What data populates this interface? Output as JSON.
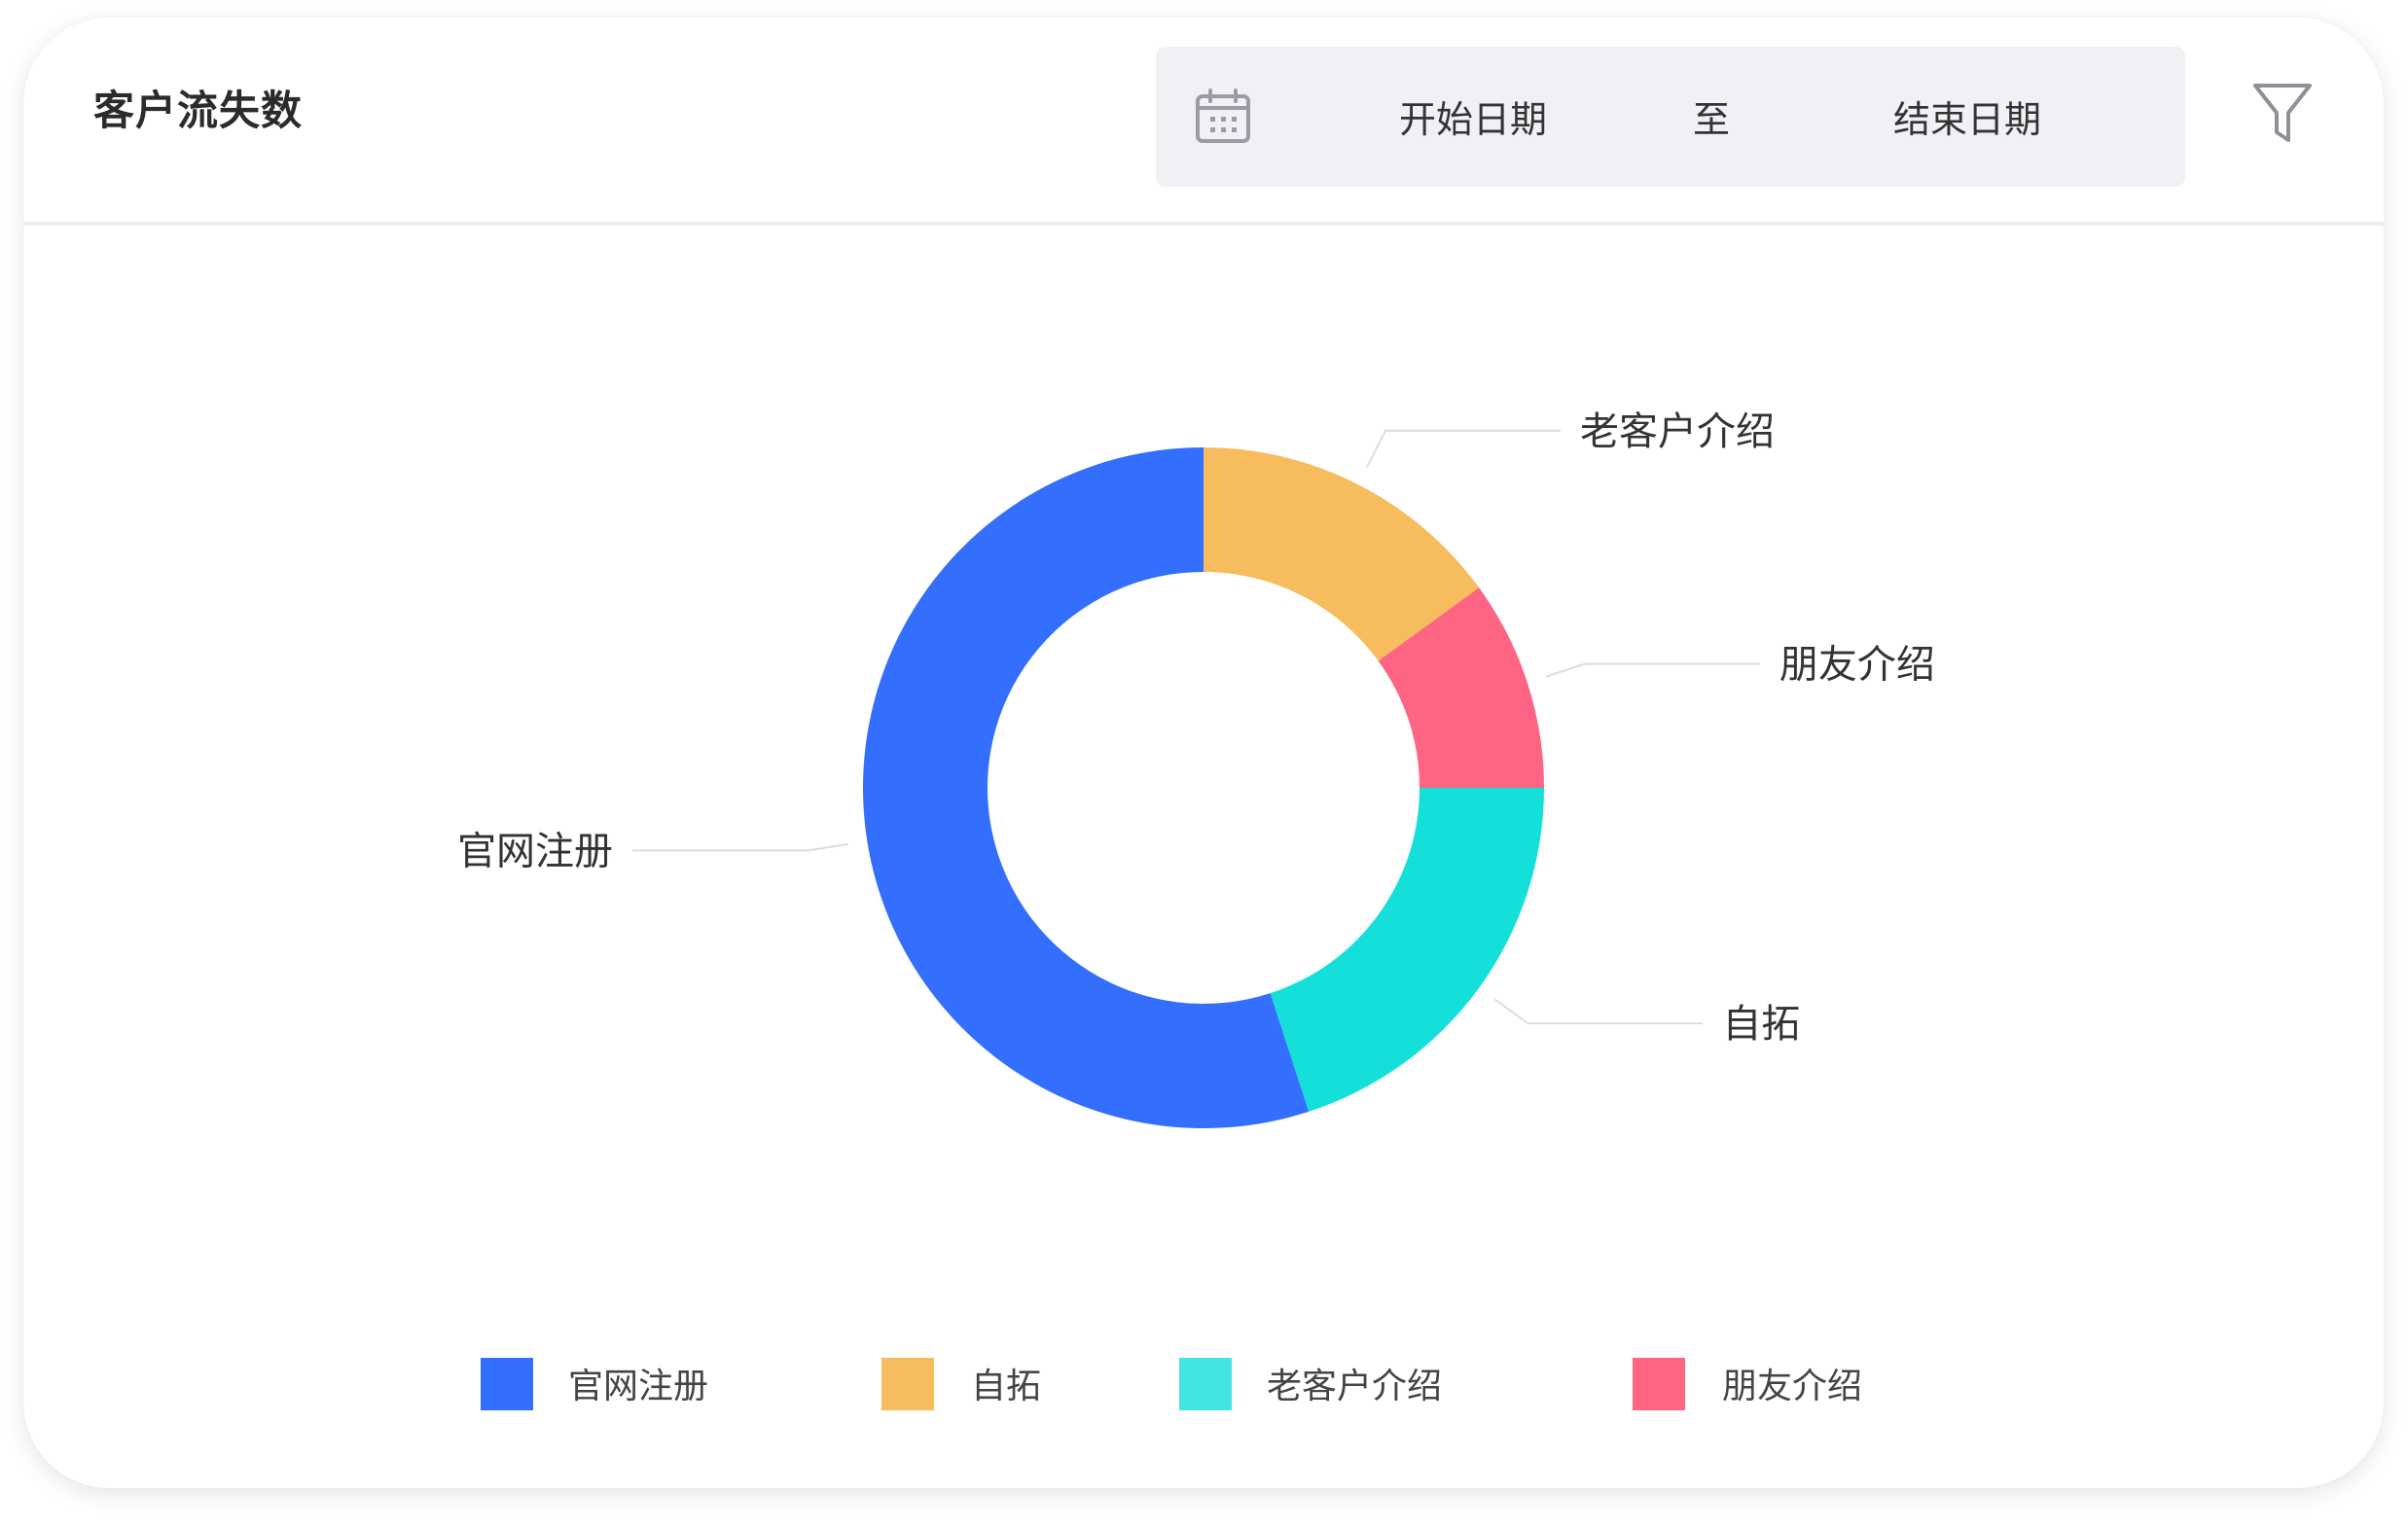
{
  "header": {
    "title": "客户流失数",
    "start_date_placeholder": "开始日期",
    "separator": "至",
    "end_date_placeholder": "结束日期",
    "calendar_icon": "calendar-icon",
    "filter_icon": "filter-icon"
  },
  "chart_data": {
    "type": "pie",
    "donut": true,
    "categories": [
      "官网注册",
      "自拓",
      "老客户介绍",
      "朋友介绍"
    ],
    "values": [
      55,
      20,
      15,
      10
    ],
    "colors": [
      "#336ffc",
      "#14e0d9",
      "#f7bc5d",
      "#fe6483"
    ],
    "legend_colors": [
      "#336ffc",
      "#f7bc5d",
      "#43e5e0",
      "#fe6483"
    ],
    "slice_order": [
      "老客户介绍",
      "朋友介绍",
      "自拓",
      "官网注册"
    ],
    "legend": [
      "官网注册",
      "自拓",
      "老客户介绍",
      "朋友介绍"
    ],
    "legend_position": "bottom"
  }
}
